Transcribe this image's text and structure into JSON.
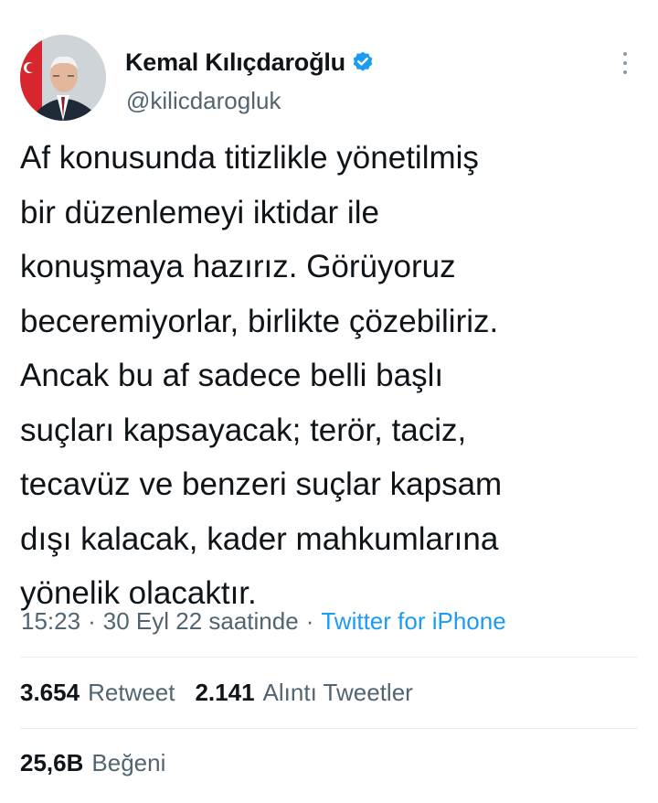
{
  "author": {
    "display_name": "Kemal Kılıçdaroğlu",
    "handle": "@kilicdarogluk",
    "verified_icon": "verified-badge-icon",
    "colors": {
      "verified": "#1d9bf0"
    }
  },
  "tweet": {
    "lines": [
      "Af konusunda titizlikle yönetilmiş",
      "bir düzenlemeyi iktidar ile",
      "konuşmaya hazırız. Görüyoruz",
      "beceremiyorlar, birlikte çözebiliriz.",
      "Ancak bu af sadece belli başlı",
      "suçları kapsayacak; terör, taciz,",
      "tecavüz ve benzeri suçlar kapsam",
      "dışı kalacak, kader mahkumlarına",
      "yönelik olacaktır."
    ]
  },
  "meta": {
    "time": "15:23",
    "separator": "·",
    "date": "30 Eyl 22 saatinde",
    "source": "Twitter for iPhone"
  },
  "stats": {
    "retweets": {
      "count": "3.654",
      "label": "Retweet"
    },
    "quotes": {
      "count": "2.141",
      "label": "Alıntı Tweetler"
    },
    "likes": {
      "count": "25,6B",
      "label": "Beğeni"
    }
  },
  "icons": {
    "more": "more-vertical-icon"
  },
  "colors": {
    "text": "#0f1419",
    "secondary": "#536471",
    "link": "#1d9bf0",
    "divider": "#e6ecf0"
  }
}
